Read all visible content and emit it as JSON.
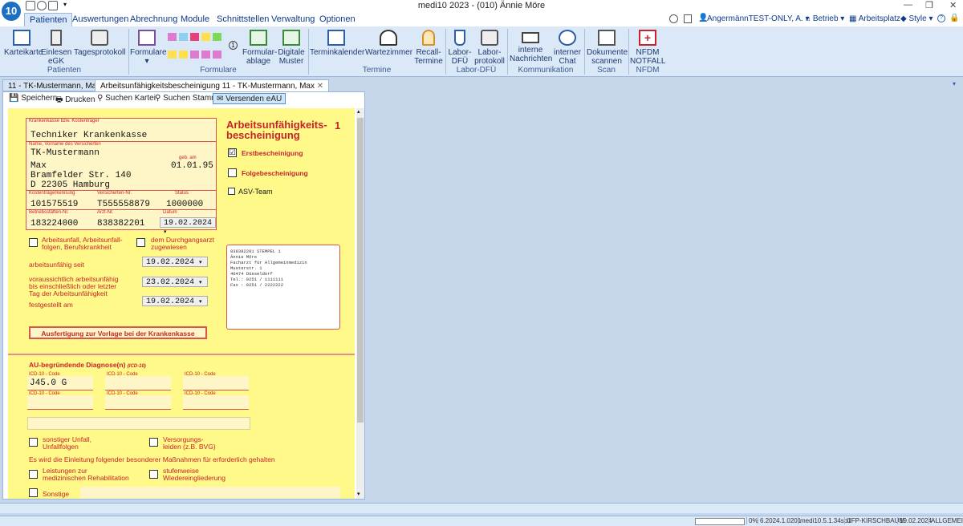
{
  "app": {
    "logo": "10",
    "title": "medi10 2023 - (010) Ännie Möre"
  },
  "menu": [
    "Patienten",
    "Auswertungen",
    "Abrechnung",
    "Module",
    "Schnittstellen",
    "Verwaltung",
    "Optionen"
  ],
  "topright": {
    "user": "AngermännTEST-ONLY, A.",
    "betrieb": "Betrieb",
    "arbeitsplatz": "Arbeitsplatz",
    "style": "Style"
  },
  "ribbon": {
    "buttons": [
      {
        "l1": "Karteikarte",
        "l2": ""
      },
      {
        "l1": "Einlesen",
        "l2": "eGK"
      },
      {
        "l1": "Tagesprotokoll",
        "l2": ""
      },
      {
        "l1": "Formulare",
        "l2": "▾"
      },
      {
        "l1": "Formular-",
        "l2": "ablage"
      },
      {
        "l1": "Digitale",
        "l2": "Muster"
      },
      {
        "l1": "Terminkalender",
        "l2": ""
      },
      {
        "l1": "Wartezimmer",
        "l2": ""
      },
      {
        "l1": "Recall-",
        "l2": "Termine"
      },
      {
        "l1": "Labor-",
        "l2": "DFÜ"
      },
      {
        "l1": "Labor-",
        "l2": "protokoll"
      },
      {
        "l1": "interne",
        "l2": "Nachrichten"
      },
      {
        "l1": "interner",
        "l2": "Chat"
      },
      {
        "l1": "Dokumente",
        "l2": "scannen"
      },
      {
        "l1": "NFDM",
        "l2": "NOTFALL"
      }
    ],
    "groups": [
      "Patienten",
      "Formulare",
      "Termine",
      "Labor-DFÜ",
      "Kommunikation",
      "Scan",
      "NFDM"
    ]
  },
  "tabs": [
    "11 - TK-Mustermann, Max",
    "Arbeitsunfähigkeitsbescheinigung  11 - TK-Mustermann, Max"
  ],
  "toolbar": [
    "Speichern",
    "Drucken",
    "Suchen Kartei",
    "Suchen Stamm",
    "Versenden eAU"
  ],
  "form": {
    "lbl_kasse": "Krankenkasse bzw. Kostenträger",
    "kasse": "Techniker Krankenkasse",
    "lbl_name": "Name, Vorname des Versicherten",
    "lastname": "TK-Mustermann",
    "firstname": "Max",
    "lbl_geb": "geb. am",
    "geb": "01.01.95",
    "street": "Bramfelder Str. 140",
    "city": "D 22305 Hamburg",
    "lbl_kk": "Kostenträgerkennung",
    "kk": "101575519",
    "lbl_vnr": "Versicherten-Nr.",
    "vnr": "T555558879",
    "lbl_status": "Status",
    "status": "1000000",
    "lbl_bsnr": "Betriebsstätten-Nr.",
    "bsnr": "183224000",
    "lbl_lanr": "Arzt-Nr.",
    "lanr": "838382201",
    "lbl_datum": "Datum",
    "datum": "19.02.2024",
    "title1": "Arbeitsunfähigkeits-",
    "title2": "bescheinigung",
    "num": "1",
    "erst": "Erstbescheinigung",
    "folge": "Folgebescheinigung",
    "asv": "ASV-Team",
    "unfall1": "Arbeitsunfall, Arbeitsunfall-",
    "unfall2": "folgen, Berufskrankheit",
    "durch1": "dem Durchgangsarzt",
    "durch2": "zugewiesen",
    "au_seit": "arbeitsunfähig seit",
    "au_seit_date": "19.02.2024",
    "bis1": "voraussichtlich arbeitsunfähig",
    "bis2": "bis einschließlich oder letzter",
    "bis3": "Tag der Arbeitsunfähigkeit",
    "bis_date": "23.02.2024",
    "fest": "festgestellt am",
    "fest_date": "19.02.2024",
    "stamp": [
      "838382201 STEMPEL 1",
      "Ännie Möre",
      "Facharzt für Allgemeinmedizin",
      "Musterstr. 1",
      "40474 Düsseldorf",
      "Tel.: 0251 / 1111111",
      "Fax : 0251 / 2222222"
    ],
    "ausfertigung": "Ausfertigung zur Vorlage bei der Krankenkasse",
    "diag_title": "AU-begründende Diagnose(n)",
    "diag_sub": "(ICD-10)",
    "icd_lbl": "ICD-10 - Code",
    "icd1": "J45.0 G",
    "sonst_unfall1": "sonstiger Unfall,",
    "sonst_unfall2": "Unfallfolgen",
    "vers1": "Versorgungs-",
    "vers2": "leiden (z.B. BVG)",
    "einleitung": "Es wird die Einleitung folgender besonderer Maßnahmen für erforderlich gehalten",
    "leist1": "Leistungen zur",
    "leist2": "medizinischen Rehabilitation",
    "stufen1": "stufenweise",
    "stufen2": "Wiedereingliederung",
    "sonstige": "Sonstige"
  },
  "status": {
    "pct": "0%",
    "v1": "6.2024.1.0201",
    "v2": "medi10.5.1.34sp1",
    "db": "UFP-KIRSCHBAUM",
    "date": "19.02.2024",
    "mode": "ALLGEMEIN"
  }
}
